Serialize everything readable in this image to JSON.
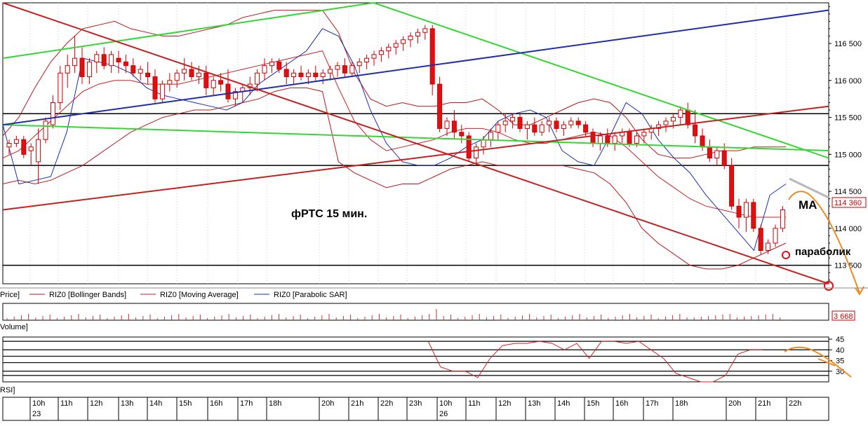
{
  "annotations": {
    "title": "фРТС    15 мин.",
    "ma": "MA",
    "parabolic": "параболик"
  },
  "legend": {
    "price": "Price]",
    "bollinger": "RIZ0 [Bollinger Bands]",
    "moving_average": "RIZ0 [Moving Average]",
    "parabolic_sar": "RIZ0 [Parabolic SAR]",
    "volume": "Volume]",
    "rsi": "RSI]"
  },
  "last_price_label": "114 360",
  "last_volume_label": "3 668",
  "colors": {
    "up": "#ffffff",
    "down": "#dd1111",
    "candle_border": "#cc0000",
    "bollinger": "#b81818",
    "moving_average": "#cc2020",
    "sar": "#1a2fb0",
    "green_line": "#34d634",
    "blue_line": "#1f2fa8",
    "red_line": "#c42020",
    "forecast": "#f08a1e",
    "forecast_gray": "#b8b8b8"
  },
  "chart_data": [
    {
      "type": "candlestick",
      "title": "фРТС    15 мин.",
      "ylim": [
        113250,
        117050
      ],
      "y_ticks": [
        "113 500",
        "114 000",
        "114 500",
        "115 000",
        "115 500",
        "116 000",
        "116 500"
      ],
      "y_tick_values": [
        113500,
        114000,
        114500,
        115000,
        115500,
        116000,
        116500
      ],
      "x_labels": [
        "10h",
        "11h",
        "12h",
        "13h",
        "14h",
        "15h",
        "16h",
        "17h",
        "18h",
        "20h",
        "21h",
        "22h",
        "23h",
        "10h",
        "11h",
        "12h",
        "13h",
        "14h",
        "15h",
        "16h",
        "17h",
        "18h",
        "20h",
        "21h",
        "22h"
      ],
      "date_labels": [
        "23",
        "26"
      ],
      "horizontal_levels": [
        115550,
        114850,
        113500
      ],
      "candles": [
        [
          115100,
          115200,
          115000,
          115150
        ],
        [
          115150,
          115250,
          115100,
          115200
        ],
        [
          115200,
          115250,
          114950,
          115000
        ],
        [
          115050,
          115150,
          114850,
          115100
        ],
        [
          114900,
          115350,
          114600,
          115200
        ],
        [
          115200,
          115500,
          115150,
          115450
        ],
        [
          115400,
          115800,
          115350,
          115700
        ],
        [
          115700,
          116200,
          115600,
          116100
        ],
        [
          116100,
          116350,
          115900,
          116200
        ],
        [
          116200,
          116600,
          116100,
          116300
        ],
        [
          116300,
          116450,
          115950,
          116050
        ],
        [
          116050,
          116300,
          115950,
          116250
        ],
        [
          116250,
          116400,
          116100,
          116350
        ],
        [
          116350,
          116450,
          116150,
          116200
        ],
        [
          116200,
          116400,
          116100,
          116350
        ],
        [
          116300,
          116400,
          116100,
          116250
        ],
        [
          116250,
          116350,
          116100,
          116200
        ],
        [
          116200,
          116300,
          116050,
          116100
        ],
        [
          116100,
          116200,
          116000,
          116150
        ],
        [
          116100,
          116250,
          115950,
          116050
        ],
        [
          116050,
          116150,
          115700,
          115750
        ],
        [
          115750,
          116000,
          115700,
          115950
        ],
        [
          115950,
          116100,
          115850,
          116000
        ],
        [
          116000,
          116150,
          115900,
          116100
        ],
        [
          116100,
          116300,
          116000,
          116150
        ],
        [
          116150,
          116250,
          116000,
          116050
        ],
        [
          116050,
          116200,
          115950,
          116100
        ],
        [
          116100,
          116200,
          115800,
          115900
        ],
        [
          115900,
          116050,
          115800,
          116000
        ],
        [
          116000,
          116100,
          115850,
          115950
        ],
        [
          115950,
          116150,
          115700,
          115750
        ],
        [
          115750,
          115900,
          115650,
          115850
        ],
        [
          115850,
          115950,
          115700,
          115900
        ],
        [
          115900,
          116050,
          115800,
          115950
        ],
        [
          115950,
          116150,
          115850,
          116100
        ],
        [
          116100,
          116300,
          116000,
          116200
        ],
        [
          116200,
          116300,
          116100,
          116250
        ],
        [
          116250,
          116300,
          116100,
          116150
        ],
        [
          116150,
          116250,
          115950,
          116050
        ],
        [
          116050,
          116150,
          115950,
          116100
        ],
        [
          116100,
          116200,
          116000,
          116050
        ],
        [
          116050,
          116150,
          115950,
          116100
        ],
        [
          116100,
          116200,
          116000,
          116050
        ],
        [
          116050,
          116150,
          115950,
          116100
        ],
        [
          116100,
          116200,
          116000,
          116150
        ],
        [
          116150,
          116250,
          116050,
          116200
        ],
        [
          116200,
          116300,
          116050,
          116100
        ],
        [
          116100,
          116250,
          116050,
          116200
        ],
        [
          116200,
          116300,
          116100,
          116250
        ],
        [
          116250,
          116350,
          116150,
          116300
        ],
        [
          116300,
          116400,
          116200,
          116350
        ],
        [
          116350,
          116450,
          116250,
          116400
        ],
        [
          116400,
          116500,
          116300,
          116450
        ],
        [
          116450,
          116550,
          116350,
          116500
        ],
        [
          116500,
          116600,
          116400,
          116550
        ],
        [
          116550,
          116650,
          116450,
          116600
        ],
        [
          116600,
          116700,
          116500,
          116650
        ],
        [
          116650,
          116750,
          116550,
          116700
        ],
        [
          116700,
          116750,
          115800,
          115950
        ],
        [
          115950,
          116050,
          115300,
          115350
        ],
        [
          115350,
          115500,
          115250,
          115450
        ],
        [
          115450,
          115600,
          115200,
          115300
        ],
        [
          115300,
          115400,
          115150,
          115250
        ],
        [
          115250,
          115300,
          114900,
          114950
        ],
        [
          114950,
          115150,
          114850,
          115100
        ],
        [
          115100,
          115250,
          115000,
          115200
        ],
        [
          115200,
          115350,
          115100,
          115300
        ],
        [
          115300,
          115450,
          115200,
          115400
        ],
        [
          115400,
          115550,
          115300,
          115450
        ],
        [
          115450,
          115550,
          115350,
          115500
        ],
        [
          115500,
          115550,
          115300,
          115350
        ],
        [
          115350,
          115450,
          115200,
          115400
        ],
        [
          115400,
          115500,
          115250,
          115300
        ],
        [
          115300,
          115450,
          115250,
          115400
        ],
        [
          115400,
          115500,
          115300,
          115450
        ],
        [
          115450,
          115500,
          115300,
          115350
        ],
        [
          115350,
          115450,
          115250,
          115400
        ],
        [
          115400,
          115500,
          115350,
          115450
        ],
        [
          115450,
          115500,
          115350,
          115400
        ],
        [
          115400,
          115450,
          115250,
          115300
        ],
        [
          115300,
          115350,
          115100,
          115150
        ],
        [
          115150,
          115300,
          115050,
          115250
        ],
        [
          115250,
          115350,
          115100,
          115150
        ],
        [
          115150,
          115300,
          115050,
          115250
        ],
        [
          115250,
          115350,
          115150,
          115300
        ],
        [
          115300,
          115350,
          115100,
          115150
        ],
        [
          115150,
          115300,
          115100,
          115250
        ],
        [
          115250,
          115350,
          115150,
          115300
        ],
        [
          115300,
          115400,
          115200,
          115350
        ],
        [
          115350,
          115450,
          115250,
          115400
        ],
        [
          115400,
          115500,
          115300,
          115450
        ],
        [
          115450,
          115550,
          115350,
          115500
        ],
        [
          115500,
          115650,
          115400,
          115600
        ],
        [
          115600,
          115700,
          115350,
          115400
        ],
        [
          115400,
          115600,
          115150,
          115250
        ],
        [
          115250,
          115350,
          115050,
          115100
        ],
        [
          115100,
          115200,
          114900,
          114950
        ],
        [
          114950,
          115100,
          114850,
          115050
        ],
        [
          115050,
          115150,
          114800,
          114850
        ],
        [
          114850,
          114950,
          114250,
          114300
        ],
        [
          114300,
          114400,
          114000,
          114150
        ],
        [
          114150,
          114400,
          113950,
          114350
        ],
        [
          114350,
          114400,
          113950,
          114000
        ],
        [
          114000,
          114050,
          113650,
          113700
        ],
        [
          113700,
          113850,
          113650,
          113800
        ],
        [
          113800,
          114050,
          113750,
          114000
        ],
        [
          114000,
          114300,
          113950,
          114250
        ],
        [
          114250,
          114450,
          114200,
          114400
        ],
        [
          114400,
          114450,
          114300,
          114350
        ],
        [
          114350,
          114450,
          114300,
          114360
        ]
      ],
      "bollinger_upper": [
        115250,
        115500,
        115900,
        116250,
        116500,
        116700,
        116750,
        116800,
        116700,
        116650,
        116600,
        116600,
        116650,
        116700,
        116750,
        116850,
        116900,
        116950,
        116950,
        116950,
        116950,
        116650,
        116100,
        115750,
        115650,
        115700,
        115650,
        115650,
        115700,
        115700,
        115750,
        115600,
        115400,
        115400,
        115500,
        115600,
        115700,
        115750,
        115700,
        115500,
        115200,
        115000,
        114950,
        114950,
        115000,
        115050,
        115050,
        115100,
        115100,
        115100
      ],
      "bollinger_lower": [
        114600,
        114650,
        114600,
        114650,
        114750,
        114850,
        115000,
        115150,
        115300,
        115400,
        115500,
        115550,
        115600,
        115600,
        115650,
        115700,
        115750,
        115850,
        115900,
        115900,
        115850,
        114900,
        114750,
        114650,
        114550,
        114600,
        114600,
        114700,
        114800,
        114850,
        114900,
        114850,
        114850,
        114850,
        114850,
        114850,
        114800,
        114750,
        114600,
        114350,
        114000,
        113800,
        113650,
        113500,
        113450,
        113450,
        113500,
        113600,
        113700,
        113800
      ],
      "moving_average": [
        114950,
        115050,
        115250,
        115450,
        115650,
        115850,
        115950,
        116000,
        116000,
        115950,
        115950,
        115950,
        116000,
        116050,
        116100,
        116150,
        116200,
        116250,
        116300,
        116350,
        116400,
        115900,
        115450,
        115200,
        115050,
        115100,
        115150,
        115200,
        115300,
        115350,
        115350,
        115300,
        115200,
        115150,
        115150,
        115200,
        115250,
        115300,
        115250,
        115100,
        114900,
        114700,
        114550,
        114400,
        114300,
        114250,
        114200,
        114150,
        114150,
        114150
      ],
      "parabolic_sar": [
        115400,
        114600,
        114650,
        114700,
        115300,
        116300,
        116250,
        116200,
        116100,
        115900,
        115800,
        115750,
        115700,
        115650,
        115600,
        115700,
        115950,
        116100,
        116250,
        116400,
        116700,
        116600,
        116200,
        115600,
        115150,
        114900,
        114850,
        114850,
        114950,
        115100,
        115200,
        115450,
        115550,
        115600,
        115500,
        115050,
        114900,
        114850,
        115250,
        115700,
        115550,
        115200,
        114950,
        114750,
        114450,
        114200,
        113950,
        113700,
        114450,
        114600
      ],
      "trend_lines": [
        {
          "color": "green",
          "from": [
            0,
            116300
          ],
          "to": [
            0.449,
            117050
          ]
        },
        {
          "color": "green",
          "from": [
            0.449,
            117050
          ],
          "to": [
            1,
            114950
          ]
        },
        {
          "color": "green",
          "from": [
            0,
            115400
          ],
          "to": [
            1,
            115050
          ]
        },
        {
          "color": "blue",
          "from": [
            0,
            115400
          ],
          "to": [
            1,
            116950
          ]
        },
        {
          "color": "red",
          "from": [
            0,
            117050
          ],
          "to": [
            1,
            113250
          ]
        },
        {
          "color": "red",
          "from": [
            0,
            114250
          ],
          "to": [
            1,
            115650
          ]
        }
      ]
    },
    {
      "type": "bar",
      "title": "Volume",
      "last_value": 3668
    },
    {
      "type": "line",
      "title": "RSI",
      "ylim": [
        25,
        46
      ],
      "y_ticks": [
        "30",
        "35",
        "40",
        "45"
      ],
      "y_tick_values": [
        30,
        35,
        40,
        45
      ],
      "levels": [
        44,
        40,
        37,
        34,
        30,
        28
      ],
      "series_x": [
        0.515,
        0.53,
        0.545,
        0.56,
        0.575,
        0.59,
        0.605,
        0.62,
        0.635,
        0.65,
        0.665,
        0.68,
        0.695,
        0.71,
        0.725,
        0.74,
        0.755,
        0.77,
        0.785,
        0.8,
        0.815,
        0.83,
        0.845,
        0.86,
        0.875,
        0.89,
        0.905,
        0.92
      ],
      "values": [
        44,
        32,
        30,
        30,
        27,
        36,
        42,
        43,
        43,
        44,
        43,
        40,
        43,
        36,
        44,
        44,
        43,
        44,
        40,
        36,
        29,
        27,
        25,
        25,
        28,
        38,
        40,
        40
      ]
    }
  ]
}
